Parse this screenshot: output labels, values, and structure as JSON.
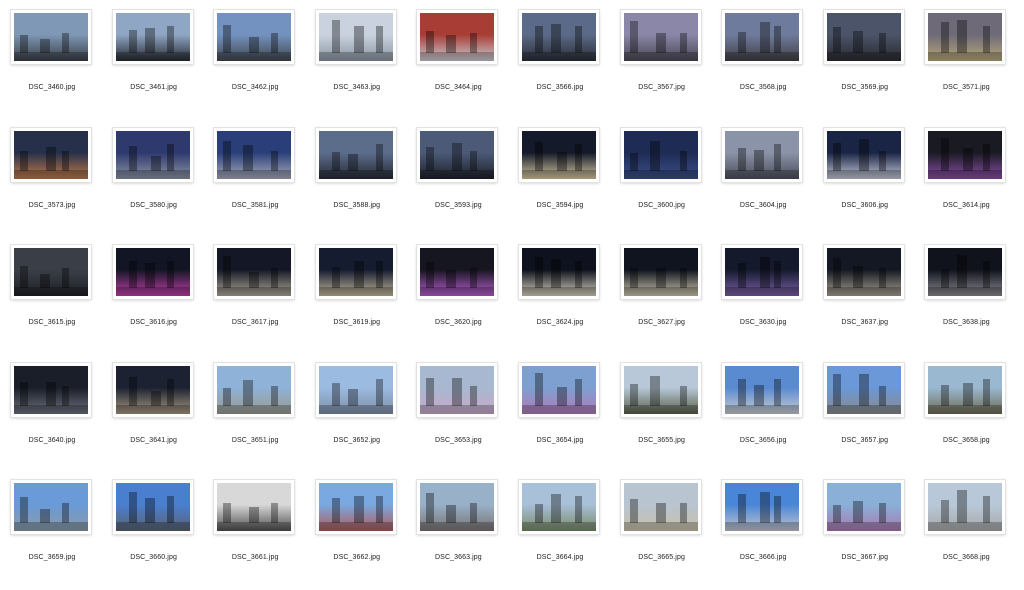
{
  "files": [
    {
      "name": "DSC_3460.jpg",
      "sky": "#7e98b5",
      "city": "#3c3f47"
    },
    {
      "name": "DSC_3461.jpg",
      "sky": "#8fa6c4",
      "city": "#262a30"
    },
    {
      "name": "DSC_3462.jpg",
      "sky": "#7392bf",
      "city": "#43474f"
    },
    {
      "name": "DSC_3463.jpg",
      "sky": "#c9d2de",
      "city": "#8c95a3"
    },
    {
      "name": "DSC_3464.jpg",
      "sky": "#a83d36",
      "city": "#c8ccd2"
    },
    {
      "name": "DSC_3566.jpg",
      "sky": "#5b6a88",
      "city": "#2b2e36"
    },
    {
      "name": "DSC_3567.jpg",
      "sky": "#8a87a8",
      "city": "#4a4752"
    },
    {
      "name": "DSC_3568.jpg",
      "sky": "#6f7b9c",
      "city": "#413f45"
    },
    {
      "name": "DSC_3569.jpg",
      "sky": "#4b5468",
      "city": "#2a2a30"
    },
    {
      "name": "DSC_3571.jpg",
      "sky": "#6e6a78",
      "city": "#b8a878"
    },
    {
      "name": "DSC_3573.jpg",
      "sky": "#26304a",
      "city": "#c07a4a"
    },
    {
      "name": "DSC_3580.jpg",
      "sky": "#2e3a6e",
      "city": "#8c93a3"
    },
    {
      "name": "DSC_3581.jpg",
      "sky": "#2a3f7a",
      "city": "#a6a9b8"
    },
    {
      "name": "DSC_3588.jpg",
      "sky": "#5c6d8c",
      "city": "#262a33"
    },
    {
      "name": "DSC_3593.jpg",
      "sky": "#4c5a78",
      "city": "#1e2128"
    },
    {
      "name": "DSC_3594.jpg",
      "sky": "#141a2a",
      "city": "#d8c9a0"
    },
    {
      "name": "DSC_3600.jpg",
      "sky": "#1e2b55",
      "city": "#3a4f88"
    },
    {
      "name": "DSC_3604.jpg",
      "sky": "#8a93a8",
      "city": "#4b4f5a"
    },
    {
      "name": "DSC_3606.jpg",
      "sky": "#1a2445",
      "city": "#c6cad8"
    },
    {
      "name": "DSC_3614.jpg",
      "sky": "#1a1a22",
      "city": "#8a4fa8"
    },
    {
      "name": "DSC_3615.jpg",
      "sky": "#3a3f47",
      "city": "#1e2026"
    },
    {
      "name": "DSC_3616.jpg",
      "sky": "#121624",
      "city": "#c03fa8"
    },
    {
      "name": "DSC_3617.jpg",
      "sky": "#141826",
      "city": "#b0a898"
    },
    {
      "name": "DSC_3619.jpg",
      "sky": "#151c30",
      "city": "#c4b89a"
    },
    {
      "name": "DSC_3620.jpg",
      "sky": "#161620",
      "city": "#b85fd0"
    },
    {
      "name": "DSC_3624.jpg",
      "sky": "#0e121e",
      "city": "#d8d2c0"
    },
    {
      "name": "DSC_3627.jpg",
      "sky": "#10141f",
      "city": "#d0c8b0"
    },
    {
      "name": "DSC_3630.jpg",
      "sky": "#141a2c",
      "city": "#7a5fa8"
    },
    {
      "name": "DSC_3637.jpg",
      "sky": "#141822",
      "city": "#a8a090"
    },
    {
      "name": "DSC_3638.jpg",
      "sky": "#10131c",
      "city": "#8a8a90"
    },
    {
      "name": "DSC_3640.jpg",
      "sky": "#1a1e28",
      "city": "#6e7280"
    },
    {
      "name": "DSC_3641.jpg",
      "sky": "#1c2232",
      "city": "#a89880"
    },
    {
      "name": "DSC_3651.jpg",
      "sky": "#8fb2d8",
      "city": "#9a9a8e"
    },
    {
      "name": "DSC_3652.jpg",
      "sky": "#9cbbe0",
      "city": "#7e8ea8"
    },
    {
      "name": "DSC_3653.jpg",
      "sky": "#a8b8d0",
      "city": "#c8a8c8"
    },
    {
      "name": "DSC_3654.jpg",
      "sky": "#7ea0d0",
      "city": "#b07ab8"
    },
    {
      "name": "DSC_3655.jpg",
      "sky": "#b8c8d8",
      "city": "#5a6048"
    },
    {
      "name": "DSC_3656.jpg",
      "sky": "#5a8ad0",
      "city": "#c8ccd0"
    },
    {
      "name": "DSC_3657.jpg",
      "sky": "#6a98d8",
      "city": "#8a8a88"
    },
    {
      "name": "DSC_3658.jpg",
      "sky": "#9ab8d0",
      "city": "#6e6a52"
    },
    {
      "name": "DSC_3659.jpg",
      "sky": "#6a9ad8",
      "city": "#8a9aa8"
    },
    {
      "name": "DSC_3660.jpg",
      "sky": "#4a7fd0",
      "city": "#5a6270"
    },
    {
      "name": "DSC_3661.jpg",
      "sky": "#d8d8d8",
      "city": "#505050"
    },
    {
      "name": "DSC_3662.jpg",
      "sky": "#7aa8e0",
      "city": "#b05a5a"
    },
    {
      "name": "DSC_3663.jpg",
      "sky": "#98b0c8",
      "city": "#7a7472"
    },
    {
      "name": "DSC_3664.jpg",
      "sky": "#a8c0d8",
      "city": "#7a8a68"
    },
    {
      "name": "DSC_3665.jpg",
      "sky": "#b8c4d0",
      "city": "#c8c0a8"
    },
    {
      "name": "DSC_3666.jpg",
      "sky": "#4a86d8",
      "city": "#c0c4cc"
    },
    {
      "name": "DSC_3667.jpg",
      "sky": "#8ab0d8",
      "city": "#a87ab0"
    },
    {
      "name": "DSC_3668.jpg",
      "sky": "#b8c8d8",
      "city": "#a8a8a8"
    }
  ]
}
